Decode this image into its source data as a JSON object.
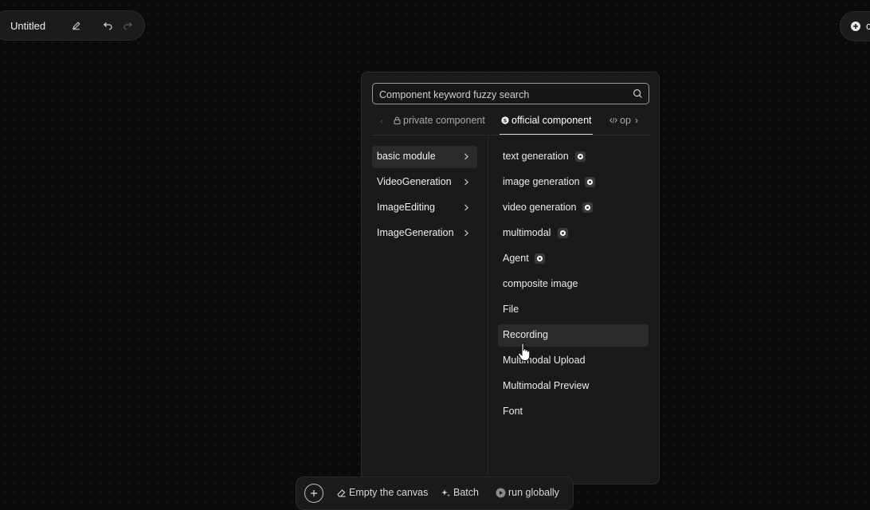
{
  "header": {
    "title": "Untitled",
    "edit_icon": "pencil-icon",
    "undo_icon": "undo-icon",
    "redo_icon": "redo-icon",
    "right_button_partial_label": "c"
  },
  "panel": {
    "search": {
      "placeholder": "Component keyword fuzzy search",
      "value": ""
    },
    "tabs": [
      {
        "label": "private component",
        "icon": "lock-icon",
        "active": false
      },
      {
        "label": "official component",
        "icon": "official-badge-icon",
        "active": true
      },
      {
        "label": "op",
        "icon": "code-icon",
        "active": false
      }
    ],
    "categories": [
      {
        "label": "basic module",
        "active": true
      },
      {
        "label": "VideoGeneration",
        "active": false
      },
      {
        "label": "ImageEditing",
        "active": false
      },
      {
        "label": "ImageGeneration",
        "active": false
      }
    ],
    "items": [
      {
        "label": "text generation",
        "badge": true
      },
      {
        "label": "image generation",
        "badge": true
      },
      {
        "label": "video generation",
        "badge": true
      },
      {
        "label": "multimodal",
        "badge": true
      },
      {
        "label": "Agent",
        "badge": true
      },
      {
        "label": "composite image",
        "badge": false
      },
      {
        "label": "File",
        "badge": false
      },
      {
        "label": "Recording",
        "badge": false,
        "hover": true
      },
      {
        "label": "Multimodal Upload",
        "badge": false
      },
      {
        "label": "Multimodal Preview",
        "badge": false
      },
      {
        "label": "Font",
        "badge": false
      }
    ]
  },
  "bottombar": {
    "add_icon": "plus-icon",
    "empty_label": "Empty the canvas",
    "batch_label": "Batch",
    "run_label": "run globally"
  },
  "colors": {
    "background": "#0a0a0a",
    "panel": "#1a1a1a",
    "hover": "#2b2b2b",
    "text": "#ececec"
  }
}
